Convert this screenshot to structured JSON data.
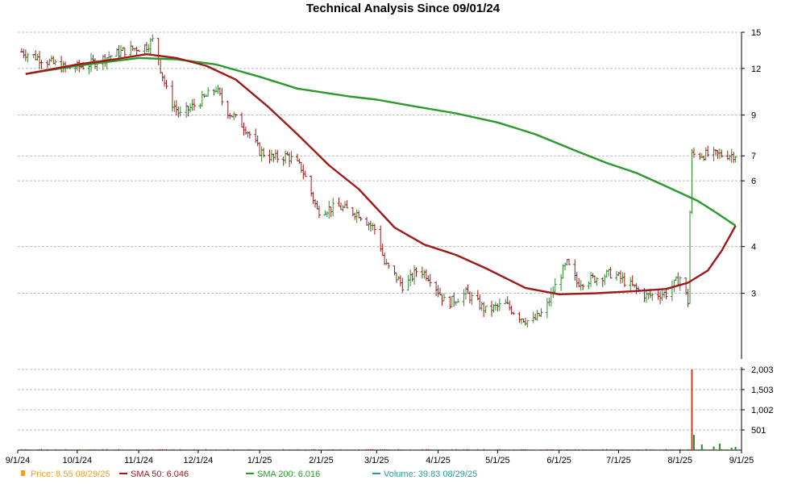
{
  "chart_data": {
    "type": "line",
    "title": "Technical Analysis Since 09/01/24",
    "colors": {
      "price_up": "#2e8b2e",
      "price_down": "#a01818",
      "sma50": "#a01818",
      "sma200": "#2a9a2a",
      "volume": "#20a0a0",
      "price_marker": "#f0a020",
      "grid": "#bbbbbb"
    },
    "price_axis": {
      "min": 2,
      "max": 15,
      "scale": "log",
      "ticks": [
        "15",
        "12",
        "9",
        "7",
        "6",
        "4",
        "3"
      ],
      "tick_values": [
        15,
        12,
        9,
        7,
        6,
        4,
        3
      ]
    },
    "volume_axis": {
      "min": 0,
      "max": 2003,
      "ticks": [
        "2,003",
        "1,503",
        "1,002",
        "501"
      ],
      "tick_values": [
        2003,
        1503,
        1002,
        501
      ]
    },
    "x_axis": {
      "start": "2024-09-01",
      "end": "2025-09-01",
      "ticks": [
        "9/1/24",
        "10/1/24",
        "11/1/24",
        "12/1/24",
        "1/1/25",
        "2/1/25",
        "3/1/25",
        "4/1/25",
        "5/1/25",
        "6/1/25",
        "7/1/25",
        "8/1/25",
        "9/1/25"
      ],
      "tick_dates": [
        "2024-09-01",
        "2024-10-01",
        "2024-11-01",
        "2024-12-01",
        "2025-01-01",
        "2025-02-01",
        "2025-03-01",
        "2025-04-01",
        "2025-05-01",
        "2025-06-01",
        "2025-07-01",
        "2025-08-01",
        "2025-09-01"
      ]
    },
    "price_anchors": [
      [
        "2024-09-03",
        13.3
      ],
      [
        "2024-09-15",
        12.6
      ],
      [
        "2024-09-25",
        12.0
      ],
      [
        "2024-10-05",
        12.2
      ],
      [
        "2024-10-15",
        12.8
      ],
      [
        "2024-10-25",
        13.4
      ],
      [
        "2024-11-05",
        13.8
      ],
      [
        "2024-11-09",
        14.4
      ],
      [
        "2024-11-12",
        12.0
      ],
      [
        "2024-11-16",
        10.0
      ],
      [
        "2024-11-22",
        9.0
      ],
      [
        "2024-12-02",
        9.8
      ],
      [
        "2024-12-10",
        10.6
      ],
      [
        "2024-12-15",
        9.3
      ],
      [
        "2024-12-25",
        8.3
      ],
      [
        "2025-01-01",
        7.2
      ],
      [
        "2025-01-08",
        6.9
      ],
      [
        "2025-01-15",
        7.0
      ],
      [
        "2025-01-22",
        6.5
      ],
      [
        "2025-01-30",
        5.0
      ],
      [
        "2025-02-10",
        5.1
      ],
      [
        "2025-02-20",
        4.9
      ],
      [
        "2025-03-01",
        4.4
      ],
      [
        "2025-03-05",
        3.6
      ],
      [
        "2025-03-15",
        3.1
      ],
      [
        "2025-03-22",
        3.5
      ],
      [
        "2025-03-28",
        3.3
      ],
      [
        "2025-04-05",
        2.8
      ],
      [
        "2025-04-15",
        3.0
      ],
      [
        "2025-04-25",
        2.7
      ],
      [
        "2025-05-05",
        2.8
      ],
      [
        "2025-05-12",
        2.6
      ],
      [
        "2025-05-18",
        2.5
      ],
      [
        "2025-05-25",
        2.7
      ],
      [
        "2025-06-01",
        3.3
      ],
      [
        "2025-06-05",
        3.6
      ],
      [
        "2025-06-10",
        3.2
      ],
      [
        "2025-06-20",
        3.3
      ],
      [
        "2025-06-28",
        3.4
      ],
      [
        "2025-07-05",
        3.2
      ],
      [
        "2025-07-15",
        2.95
      ],
      [
        "2025-07-25",
        3.0
      ],
      [
        "2025-08-01",
        3.3
      ],
      [
        "2025-08-05",
        2.85
      ],
      [
        "2025-08-07",
        7.05
      ],
      [
        "2025-08-29",
        7.05
      ]
    ],
    "sma50_anchors": [
      [
        "2024-09-05",
        11.6
      ],
      [
        "2024-10-01",
        12.3
      ],
      [
        "2024-10-20",
        12.7
      ],
      [
        "2024-11-05",
        13.1
      ],
      [
        "2024-11-20",
        12.8
      ],
      [
        "2024-12-05",
        12.2
      ],
      [
        "2024-12-20",
        11.2
      ],
      [
        "2025-01-05",
        9.5
      ],
      [
        "2025-01-20",
        8.0
      ],
      [
        "2025-02-05",
        6.6
      ],
      [
        "2025-02-20",
        5.7
      ],
      [
        "2025-03-10",
        4.5
      ],
      [
        "2025-03-25",
        4.05
      ],
      [
        "2025-04-10",
        3.8
      ],
      [
        "2025-04-25",
        3.5
      ],
      [
        "2025-05-15",
        3.1
      ],
      [
        "2025-06-01",
        2.98
      ],
      [
        "2025-06-20",
        3.0
      ],
      [
        "2025-07-10",
        3.04
      ],
      [
        "2025-07-25",
        3.08
      ],
      [
        "2025-08-05",
        3.2
      ],
      [
        "2025-08-15",
        3.45
      ],
      [
        "2025-08-22",
        3.9
      ],
      [
        "2025-08-29",
        4.55
      ]
    ],
    "sma200_anchors": [
      [
        "2024-09-05",
        11.6
      ],
      [
        "2024-10-01",
        12.2
      ],
      [
        "2024-11-01",
        12.8
      ],
      [
        "2024-11-20",
        12.7
      ],
      [
        "2024-12-10",
        12.3
      ],
      [
        "2025-01-01",
        11.4
      ],
      [
        "2025-01-20",
        10.6
      ],
      [
        "2025-02-15",
        10.1
      ],
      [
        "2025-03-01",
        9.9
      ],
      [
        "2025-03-20",
        9.5
      ],
      [
        "2025-04-10",
        9.1
      ],
      [
        "2025-05-01",
        8.6
      ],
      [
        "2025-05-20",
        8.0
      ],
      [
        "2025-06-10",
        7.2
      ],
      [
        "2025-06-25",
        6.7
      ],
      [
        "2025-07-10",
        6.3
      ],
      [
        "2025-07-25",
        5.8
      ],
      [
        "2025-08-10",
        5.3
      ],
      [
        "2025-08-20",
        4.9
      ],
      [
        "2025-08-29",
        4.55
      ]
    ],
    "volume_bars": [
      [
        "2025-08-07",
        2003
      ],
      [
        "2025-08-08",
        380
      ],
      [
        "2025-08-12",
        140
      ],
      [
        "2025-08-18",
        90
      ],
      [
        "2025-08-21",
        160
      ],
      [
        "2025-08-27",
        60
      ],
      [
        "2025-08-29",
        80
      ]
    ],
    "legend": [
      {
        "key": "price",
        "label": "Price: 8.55  08/29/25",
        "color": "#f0a020",
        "marker": "bar"
      },
      {
        "key": "sma50",
        "label": "SMA 50: 6.046",
        "color": "#a01818",
        "marker": "line"
      },
      {
        "key": "sma200",
        "label": "SMA 200: 6.016",
        "color": "#2a9a2a",
        "marker": "line"
      },
      {
        "key": "volume",
        "label": "Volume: 39.83  08/29/25",
        "color": "#20a0a0",
        "marker": "line"
      }
    ]
  }
}
